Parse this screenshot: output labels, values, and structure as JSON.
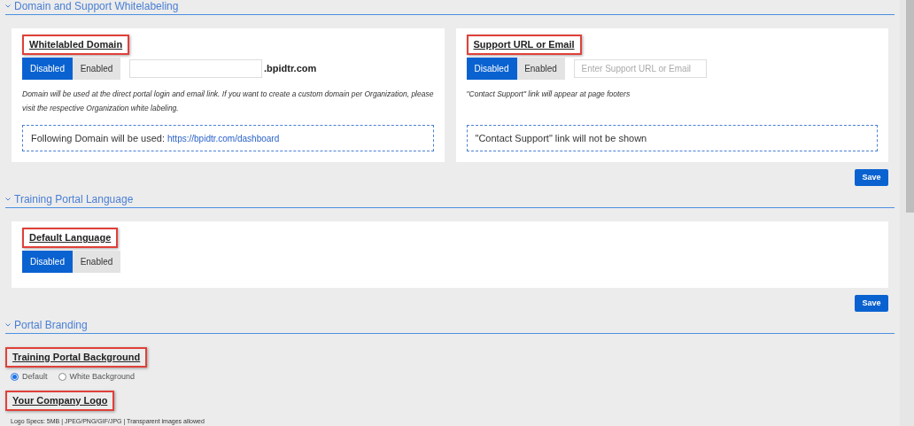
{
  "sections": [
    {
      "title": "Domain and Support Whitelabeling",
      "cards": [
        {
          "heading": "Whitelabled Domain",
          "toggle": [
            {
              "label": "Disabled",
              "selected": true
            },
            {
              "label": "Enabled",
              "selected": false
            }
          ],
          "field": {
            "suffix": ".bpidtr.com"
          },
          "note": "Domain will be used at the direct portal login and email link. If you want to create a custom domain per Organization, please visit the respective Organization white labeling.",
          "info": "Following Domain will be used:",
          "info_link": "https://bpidtr.com/dashboard"
        },
        {
          "heading": "Support URL or Email",
          "toggle": [
            {
              "label": "Disabled",
              "selected": true
            },
            {
              "label": "Enabled",
              "selected": false
            }
          ],
          "field": {
            "placeholder": "Enter Support URL or Email"
          },
          "note": "\"Contact Support\" link will appear at page footers",
          "info": "\"Contact Support\" link will not be shown"
        }
      ],
      "save": "Save"
    },
    {
      "title": "Training Portal Language",
      "cards": [
        {
          "heading": "Default Language",
          "toggle": [
            {
              "label": "Disabled",
              "selected": true
            },
            {
              "label": "Enabled",
              "selected": false
            }
          ]
        }
      ],
      "save": "Save"
    },
    {
      "title": "Portal Branding",
      "items": [
        {
          "heading": "Training Portal Background",
          "radios": [
            {
              "label": "Default",
              "selected": true
            },
            {
              "label": "White Background",
              "selected": false
            }
          ]
        },
        {
          "heading": "Your Company Logo",
          "note": "Logo Specs: 5MB | JPEG/PNG/GIF/JPG | Transparent images allowed"
        }
      ]
    }
  ]
}
